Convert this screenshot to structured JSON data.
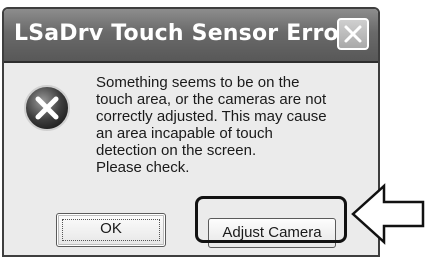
{
  "dialog": {
    "title": "LSaDrv Touch Sensor Error",
    "message_lines": [
      "Something seems to be on the",
      "touch area, or the cameras are not",
      "correctly adjusted. This may cause",
      "an area incapable of touch",
      "detection on the screen.",
      "Please check."
    ],
    "icon": "error-icon",
    "close_icon": "close-icon"
  },
  "buttons": {
    "ok_label": "OK",
    "adjust_label": "Adjust Camera"
  },
  "annotation": {
    "arrow_icon": "left-arrow-icon"
  }
}
